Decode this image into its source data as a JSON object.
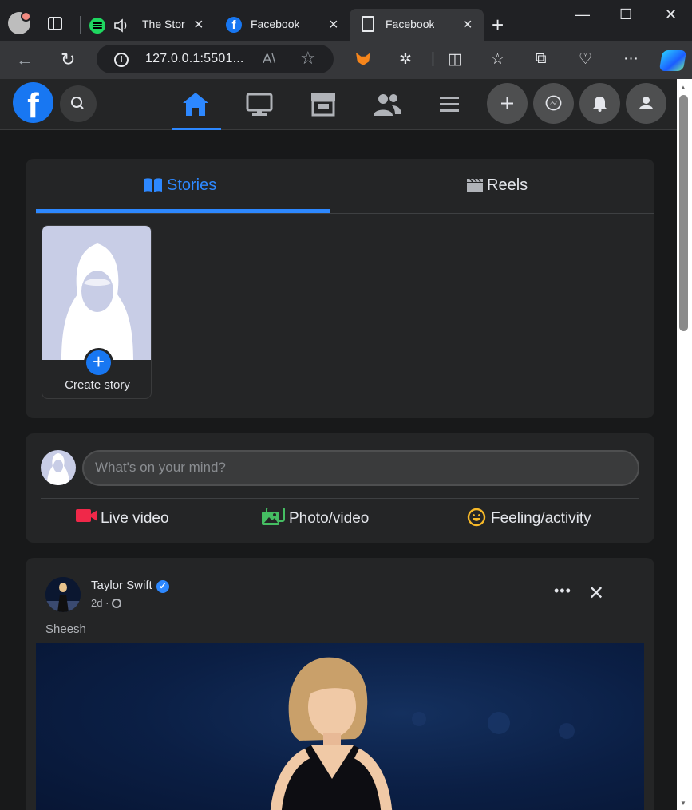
{
  "browser": {
    "tabs": [
      {
        "label": "The Stor",
        "type": "spotify"
      },
      {
        "label": "Facebook",
        "type": "facebook"
      },
      {
        "label": "Facebook",
        "type": "page",
        "active": true
      }
    ],
    "url": "127.0.0.1:5501...",
    "window_controls": [
      "—",
      "☐",
      "✕"
    ]
  },
  "fb": {
    "logo": "f",
    "nav": [
      "home",
      "watch",
      "marketplace",
      "groups",
      "menu"
    ],
    "actions": [
      "create",
      "messenger",
      "notifications",
      "account"
    ]
  },
  "stories": {
    "tab_stories": "Stories",
    "tab_reels": "Reels",
    "create_story": "Create story"
  },
  "composer": {
    "placeholder": "What's on your mind?",
    "live_video": "Live video",
    "photo_video": "Photo/video",
    "feeling": "Feeling/activity"
  },
  "post": {
    "author": "Taylor Swift",
    "time": "2d ·",
    "text": "Sheesh",
    "more": "•••",
    "close": "✕"
  },
  "colors": {
    "accent": "#2d88ff",
    "brand": "#1877f2",
    "live": "#f02849",
    "photo": "#45bd62",
    "feeling": "#f7b928"
  }
}
